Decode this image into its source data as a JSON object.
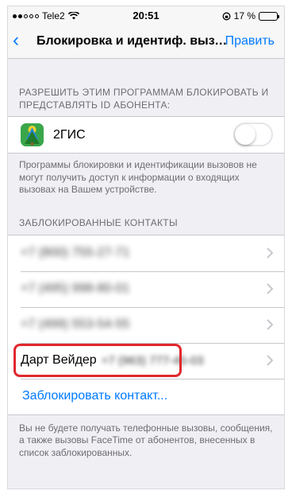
{
  "status_bar": {
    "carrier": "Tele2",
    "time": "20:51",
    "battery_percent": "17 %",
    "battery_level": 0.17
  },
  "nav": {
    "back_icon": "chevron-left",
    "title": "Блокировка и идентиф. вызо...",
    "edit_label": "Править"
  },
  "apps_section": {
    "header": "Разрешить этим программам блокировать и представлять ID абонента:",
    "apps": [
      {
        "name": "2ГИС",
        "enabled": false,
        "icon": "2gis-app-icon"
      }
    ],
    "footer": "Программы блокировки и идентификации вызовов не могут получить доступ к информации о входящих вызовах на Вашем устройстве."
  },
  "blocked_section": {
    "header": "Заблокированные контакты",
    "numbers": [
      "+7 (800) 755-27-71",
      "+7 (495) 998-80-01",
      "+7 (499) 553-54-55"
    ],
    "named_contact": {
      "name": "Дарт Вейдер",
      "number": "+7 (963) 777-45-03"
    },
    "block_action": "Заблокировать контакт...",
    "footer": "Вы не будете получать телефонные вызовы, сообщения, а также вызовы FaceTime от абонентов, внесенных в список заблокированных."
  },
  "colors": {
    "accent": "#007aff",
    "highlight": "#e0282e",
    "battery_low": "#ff3b30"
  }
}
